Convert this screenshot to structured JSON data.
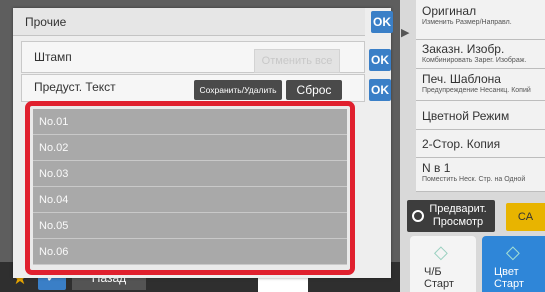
{
  "dialog": {
    "title": "Прочие",
    "ok_label": "OK",
    "stamp": {
      "label": "Штамп",
      "cancel_all_label": "Отменить все",
      "ok_label": "OK"
    },
    "preset": {
      "label": "Предуст. Текст",
      "save_delete_label": "Сохранить/Удалить",
      "reset_label": "Сброс",
      "ok_label": "OK"
    },
    "list_items": [
      "No.01",
      "No.02",
      "No.03",
      "No.04",
      "No.05",
      "No.06"
    ],
    "highlight_color": "#e0202e"
  },
  "right_panel": {
    "items": [
      {
        "main": "Оригинал",
        "sub": "Изменить Размер/Направл."
      },
      {
        "main": "Заказн. Изобр.",
        "sub": "Комбинировать Зарег. Изображ."
      },
      {
        "main": "Печ. Шаблона",
        "sub": "Предупреждение Несанкц. Копий"
      },
      {
        "main": "Цветной Режим",
        "sub": ""
      },
      {
        "main": "2-Стор. Копия",
        "sub": ""
      },
      {
        "main": "N в 1",
        "sub": "Поместить Неск. Стр. на Одной"
      }
    ],
    "preview_label_1": "Предварит.",
    "preview_label_2": "Просмотр",
    "ca_label": "CA",
    "start_bw_line1": "Ч/Б",
    "start_bw_line2": "Старт",
    "start_color_line1": "Цвет",
    "start_color_line2": "Старт"
  },
  "bottom_bar": {
    "back_label": "Назад"
  },
  "colors": {
    "accent_blue": "#3a7fc7",
    "ca_yellow": "#e8b400",
    "start_color_blue": "#2f86d8"
  }
}
